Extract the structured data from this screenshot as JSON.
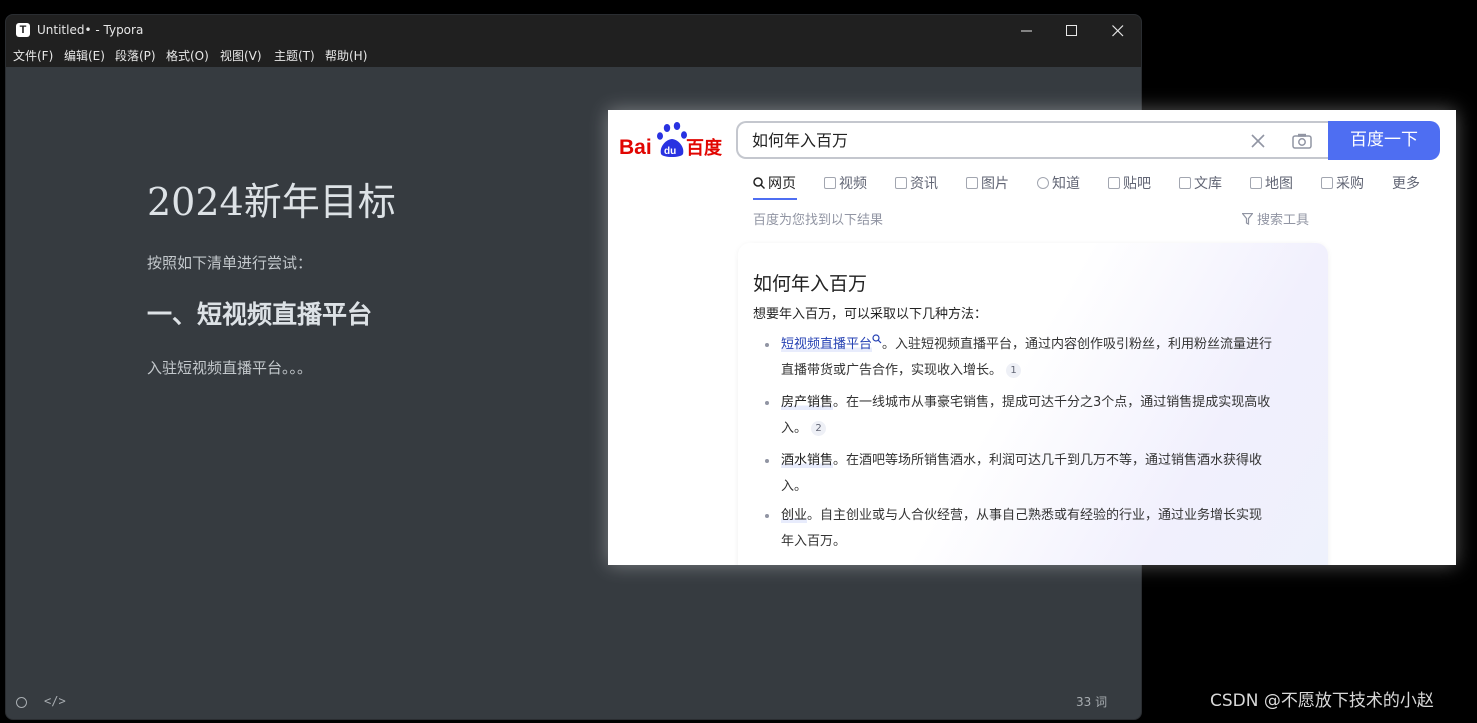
{
  "window": {
    "title": "Untitled• - Typora",
    "app_icon_letter": "T",
    "menu": [
      "文件(F)",
      "编辑(E)",
      "段落(P)",
      "格式(O)",
      "视图(V)",
      "主题(T)",
      "帮助(H)"
    ]
  },
  "document": {
    "title": "2024新年目标",
    "intro": "按照如下清单进行尝试：",
    "heading": "一、短视频直播平台",
    "paragraph": "入驻短视频直播平台。。。"
  },
  "statusbar": {
    "code_icon": "</>",
    "word_count": "33 词"
  },
  "baidu": {
    "logo_text": {
      "bai": "Bai",
      "du": "du",
      "cn": "百度"
    },
    "query": "如何年入百万",
    "search_button": "百度一下",
    "tabs": [
      "网页",
      "视频",
      "资讯",
      "图片",
      "知道",
      "贴吧",
      "文库",
      "地图",
      "采购",
      "更多"
    ],
    "result_info": "百度为您找到以下结果",
    "search_tools": "搜索工具",
    "card": {
      "title": "如何年入百万",
      "intro": "想要年入百万，可以采取以下几种方法：",
      "items": [
        {
          "keyword": "短视频直播平台",
          "text_line1": "。入驻短视频直播平台，通过内容创作吸引粉丝，利用粉丝流量进行",
          "text_line2": "直播带货或广告合作，实现收入增长。",
          "cite": "1"
        },
        {
          "keyword": "房产销售",
          "text_line1": "。在一线城市从事豪宅销售，提成可达千分之3个点，通过销售提成实现高收",
          "text_line2": "入。",
          "cite": "2"
        },
        {
          "keyword": "酒水销售",
          "text_line1": "。在酒吧等场所销售酒水，利润可达几千到几万不等，通过销售酒水获得收",
          "text_line2": "入。",
          "cite": ""
        },
        {
          "keyword": "创业",
          "text_line1": "。自主创业或与人合伙经营，从事自己熟悉或有经验的行业，通过业务增长实现",
          "text_line2": "年入百万。",
          "cite": ""
        }
      ]
    },
    "colors": {
      "brand_blue": "#4e6ef2",
      "brand_red": "#e10602",
      "link": "#2440b3"
    }
  },
  "watermark": "CSDN @不愿放下技术的小赵"
}
